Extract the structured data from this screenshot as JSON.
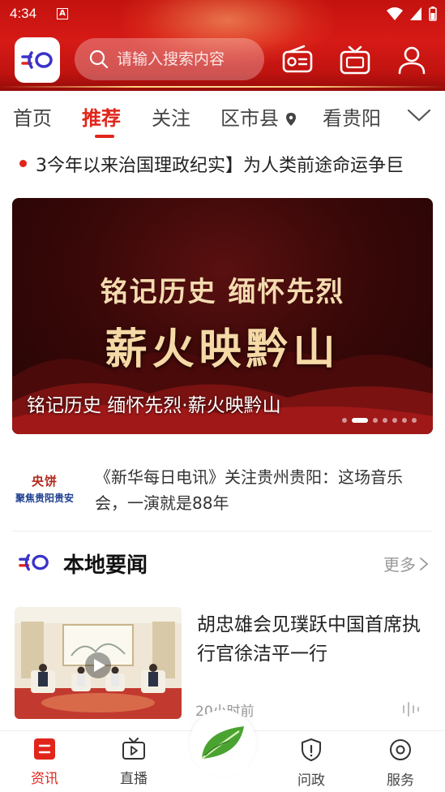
{
  "status_bar": {
    "time": "4:34",
    "notification_letter": "A"
  },
  "header": {
    "search_placeholder": "请输入搜索内容",
    "icons": [
      "radio-icon",
      "tv-icon",
      "user-icon"
    ]
  },
  "tabs": {
    "items": [
      {
        "label": "首页"
      },
      {
        "label": "推荐"
      },
      {
        "label": "关注"
      },
      {
        "label": "区市县"
      },
      {
        "label": "看贵阳"
      }
    ],
    "active": "推荐"
  },
  "ticker": {
    "text": "3今年以来治国理政纪实】为人类前途命运争巨"
  },
  "banner": {
    "line1": "铭记历史 缅怀先烈",
    "line2": "薪火映黔山",
    "caption": "铭记历史  缅怀先烈·薪火映黔山",
    "slide_count": 7,
    "active_slide": 2
  },
  "news_text": {
    "thumb_line1": "央饼",
    "thumb_line2": "聚焦贵阳贵安",
    "title": "《新华每日电讯》关注贵州贵阳：这场音乐会，一演就是88年"
  },
  "section": {
    "name": "本地要闻",
    "more": "更多"
  },
  "article": {
    "title": "胡忠雄会见璞跃中国首席执行官徐洁平一行",
    "time": "20小时前"
  },
  "bottom_nav": {
    "items": [
      {
        "label": "资讯",
        "icon": "news-icon"
      },
      {
        "label": "直播",
        "icon": "live-tv-icon"
      },
      {
        "label": "问政",
        "icon": "shield-icon"
      },
      {
        "label": "服务",
        "icon": "service-icon"
      }
    ],
    "active": "资讯"
  },
  "colors": {
    "brand_red": "#e1251b",
    "header_red": "#c3120f",
    "logo_blue": "#3b32c8"
  }
}
